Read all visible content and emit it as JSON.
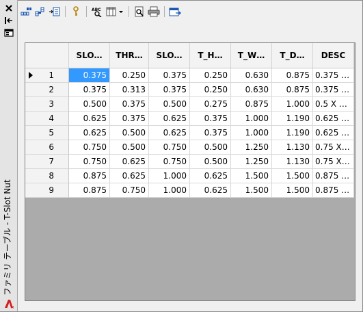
{
  "palette": {
    "title": "ファミリ テーブル - T-Slot Nut",
    "close_icon": "close-icon",
    "autohide_icon": "autohide-icon",
    "properties_icon": "properties-icon"
  },
  "toolbar": {
    "buttons": [
      "new-row-icon",
      "new-column-icon",
      "delete-icon",
      "key-icon",
      "spell-check-icon",
      "columns-dropdown-icon",
      "preview-icon",
      "print-icon",
      "export-icon"
    ]
  },
  "table": {
    "columns": [
      "SLO…",
      "THR…",
      "SLO…",
      "T_H…",
      "T_W…",
      "T_D…",
      "DESC"
    ],
    "selected_row": 1,
    "rows": [
      {
        "num": "1",
        "cells": [
          "0.375",
          "0.250",
          "0.375",
          "0.250",
          "0.630",
          "0.875",
          "0.375 …"
        ]
      },
      {
        "num": "2",
        "cells": [
          "0.375",
          "0.313",
          "0.375",
          "0.250",
          "0.630",
          "0.875",
          "0.375 …"
        ]
      },
      {
        "num": "3",
        "cells": [
          "0.500",
          "0.375",
          "0.500",
          "0.275",
          "0.875",
          "1.000",
          "0.5 X …"
        ]
      },
      {
        "num": "4",
        "cells": [
          "0.625",
          "0.375",
          "0.625",
          "0.375",
          "1.000",
          "1.190",
          "0.625 …"
        ]
      },
      {
        "num": "5",
        "cells": [
          "0.625",
          "0.500",
          "0.625",
          "0.375",
          "1.000",
          "1.190",
          "0.625 …"
        ]
      },
      {
        "num": "6",
        "cells": [
          "0.750",
          "0.500",
          "0.750",
          "0.500",
          "1.250",
          "1.130",
          "0.75 X…"
        ]
      },
      {
        "num": "7",
        "cells": [
          "0.750",
          "0.625",
          "0.750",
          "0.500",
          "1.250",
          "1.130",
          "0.75 X…"
        ]
      },
      {
        "num": "8",
        "cells": [
          "0.875",
          "0.625",
          "1.000",
          "0.625",
          "1.500",
          "1.500",
          "0.875 …"
        ]
      },
      {
        "num": "9",
        "cells": [
          "0.875",
          "0.750",
          "1.000",
          "0.625",
          "1.500",
          "1.500",
          "0.875 …"
        ]
      }
    ]
  },
  "colors": {
    "selection": "#3399ff",
    "empty_area": "#ababab"
  }
}
